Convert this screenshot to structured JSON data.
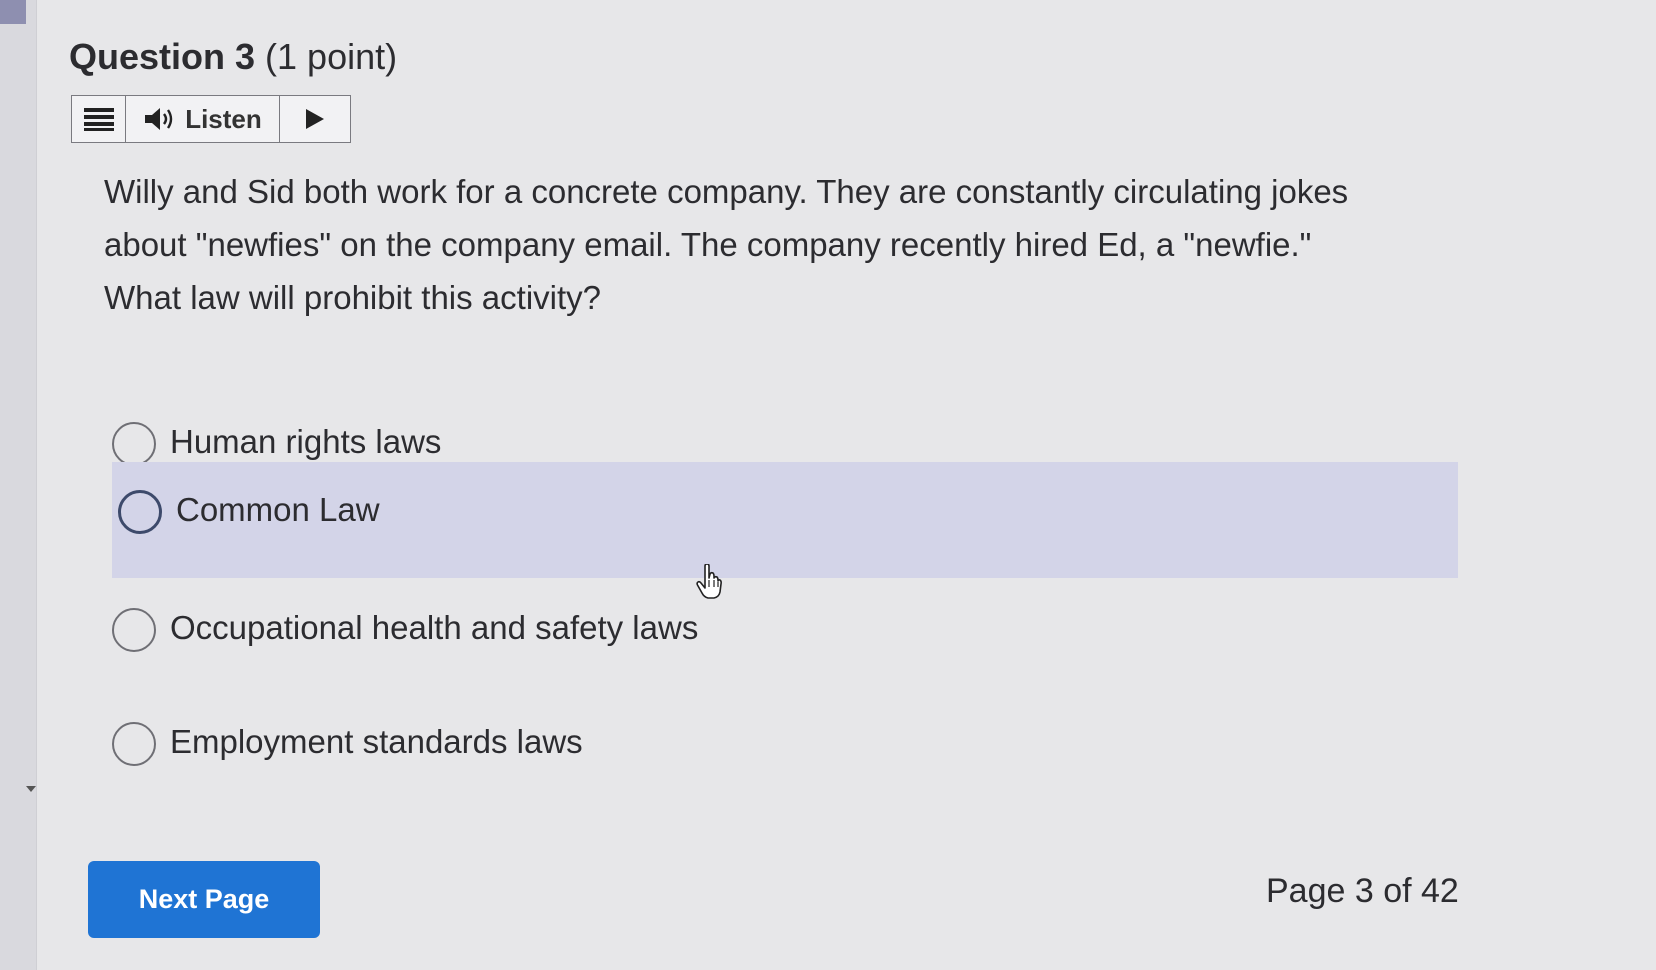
{
  "question": {
    "title": "Question 3",
    "points": "(1 point)"
  },
  "listen_toolbar": {
    "menu_icon": "hamburger-menu-icon",
    "speaker_icon": "speaker-icon",
    "listen_label": "Listen",
    "play_icon": "play-icon"
  },
  "prompt": {
    "line1": "Willy and Sid both work for a concrete company. They are constantly circulating jokes",
    "line2": "about \"newfies\" on the company email. The company recently hired Ed, a \"newfie.\"",
    "line3": "What law will prohibit this activity?"
  },
  "options": [
    {
      "label": "Human rights laws",
      "selected": false
    },
    {
      "label": "Common Law",
      "selected": false,
      "hovered": true
    },
    {
      "label": "Occupational health and safety laws",
      "selected": false
    },
    {
      "label": "Employment standards laws",
      "selected": false
    }
  ],
  "footer": {
    "next_button_label": "Next Page",
    "page_indicator": "Page 3 of 42"
  },
  "colors": {
    "accent_button": "#1f74d4",
    "hover_highlight": "#d3d4e8",
    "background": "#e7e7e9"
  }
}
